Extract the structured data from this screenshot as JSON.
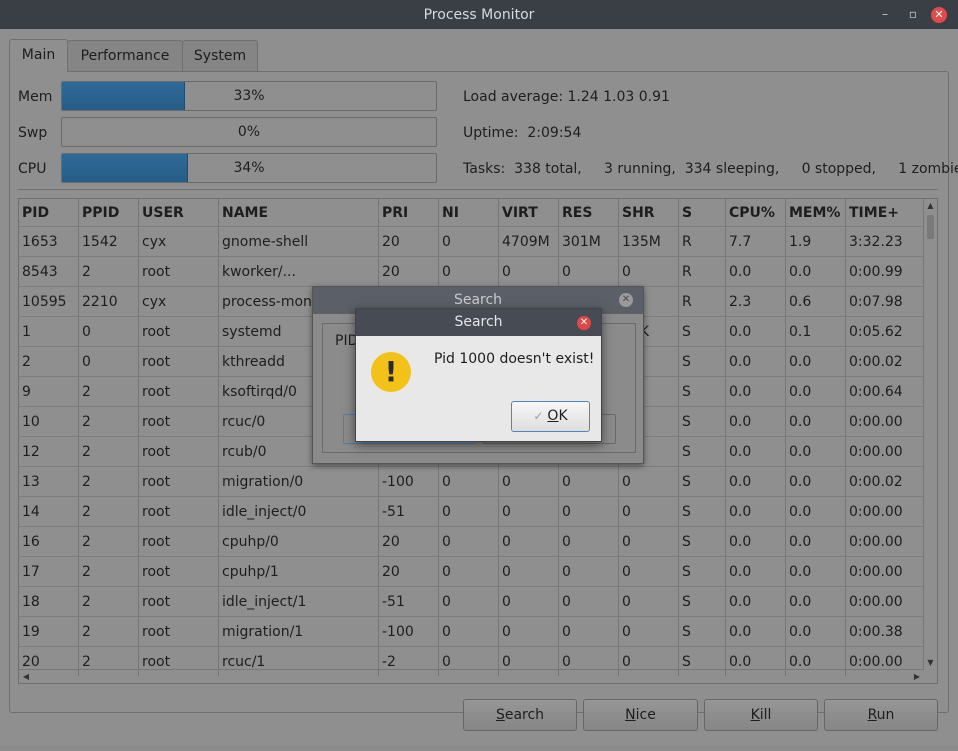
{
  "window": {
    "title": "Process Monitor",
    "controls": [
      "–",
      "▫",
      "✕"
    ]
  },
  "tabs": [
    {
      "label": "Main"
    },
    {
      "label": "Performance"
    },
    {
      "label": "System"
    }
  ],
  "meters": [
    {
      "label": "Mem",
      "value": "33%",
      "fraction": 0.33
    },
    {
      "label": "Swp",
      "value": "0%",
      "fraction": 0.0
    },
    {
      "label": "CPU",
      "value": "34%",
      "fraction": 0.34
    }
  ],
  "info": {
    "load": "Load average: 1.24 1.03 0.91",
    "uptime": "Uptime:  2:09:54",
    "tasks": "Tasks:  338 total,     3 running,  334 sleeping,     0 stopped,     1 zombie"
  },
  "table": {
    "headers": [
      "PID",
      "PPID",
      "USER",
      "NAME",
      "PRI",
      "NI",
      "VIRT",
      "RES",
      "SHR",
      "S",
      "CPU%",
      "MEM%",
      "TIME+"
    ],
    "rows": [
      [
        "1653",
        "1542",
        "cyx",
        "gnome-shell",
        "20",
        "0",
        "4709M",
        "301M",
        "135M",
        "R",
        "7.7",
        "1.9",
        "3:32.23"
      ],
      [
        "8543",
        "2",
        "root",
        "kworker/...",
        "20",
        "0",
        "0",
        "0",
        "0",
        "R",
        "0.0",
        "0.0",
        "0:00.99"
      ],
      [
        "10595",
        "2210",
        "cyx",
        "process-mon",
        "",
        "",
        "",
        "",
        "M",
        "R",
        "2.3",
        "0.6",
        "0:07.98"
      ],
      [
        "1",
        "0",
        "root",
        "systemd",
        "",
        "",
        "",
        "",
        "88K",
        "S",
        "0.0",
        "0.1",
        "0:05.62"
      ],
      [
        "2",
        "0",
        "root",
        "kthreadd",
        "",
        "",
        "",
        "",
        "",
        "S",
        "0.0",
        "0.0",
        "0:00.02"
      ],
      [
        "9",
        "2",
        "root",
        "ksoftirqd/0",
        "",
        "",
        "",
        "",
        "",
        "S",
        "0.0",
        "0.0",
        "0:00.64"
      ],
      [
        "10",
        "2",
        "root",
        "rcuc/0",
        "",
        "",
        "",
        "",
        "",
        "S",
        "0.0",
        "0.0",
        "0:00.00"
      ],
      [
        "12",
        "2",
        "root",
        "rcub/0",
        "",
        "",
        "",
        "",
        "",
        "S",
        "0.0",
        "0.0",
        "0:00.00"
      ],
      [
        "13",
        "2",
        "root",
        "migration/0",
        "-100",
        "0",
        "0",
        "0",
        "0",
        "S",
        "0.0",
        "0.0",
        "0:00.02"
      ],
      [
        "14",
        "2",
        "root",
        "idle_inject/0",
        "-51",
        "0",
        "0",
        "0",
        "0",
        "S",
        "0.0",
        "0.0",
        "0:00.00"
      ],
      [
        "16",
        "2",
        "root",
        "cpuhp/0",
        "20",
        "0",
        "0",
        "0",
        "0",
        "S",
        "0.0",
        "0.0",
        "0:00.00"
      ],
      [
        "17",
        "2",
        "root",
        "cpuhp/1",
        "20",
        "0",
        "0",
        "0",
        "0",
        "S",
        "0.0",
        "0.0",
        "0:00.00"
      ],
      [
        "18",
        "2",
        "root",
        "idle_inject/1",
        "-51",
        "0",
        "0",
        "0",
        "0",
        "S",
        "0.0",
        "0.0",
        "0:00.00"
      ],
      [
        "19",
        "2",
        "root",
        "migration/1",
        "-100",
        "0",
        "0",
        "0",
        "0",
        "S",
        "0.0",
        "0.0",
        "0:00.38"
      ],
      [
        "20",
        "2",
        "root",
        "rcuc/1",
        "-2",
        "0",
        "0",
        "0",
        "0",
        "S",
        "0.0",
        "0.0",
        "0:00.00"
      ]
    ]
  },
  "buttons": {
    "search": {
      "mnemonic": "S",
      "rest": "earch"
    },
    "nice": {
      "mnemonic": "N",
      "rest": "ice"
    },
    "kill": {
      "mnemonic": "K",
      "rest": "ill"
    },
    "run": {
      "mnemonic": "R",
      "rest": "un"
    }
  },
  "search_dialog": {
    "title": "Search",
    "pid_label": "PID"
  },
  "alert_dialog": {
    "title": "Search",
    "message": "Pid 1000 doesn't exist!",
    "ok": {
      "mnemonic": "O",
      "rest": "K"
    },
    "icon": "warning-icon"
  },
  "colors": {
    "bar_fill": "#2b6490",
    "close_red": "#e04848",
    "warning": "#f2c219"
  }
}
